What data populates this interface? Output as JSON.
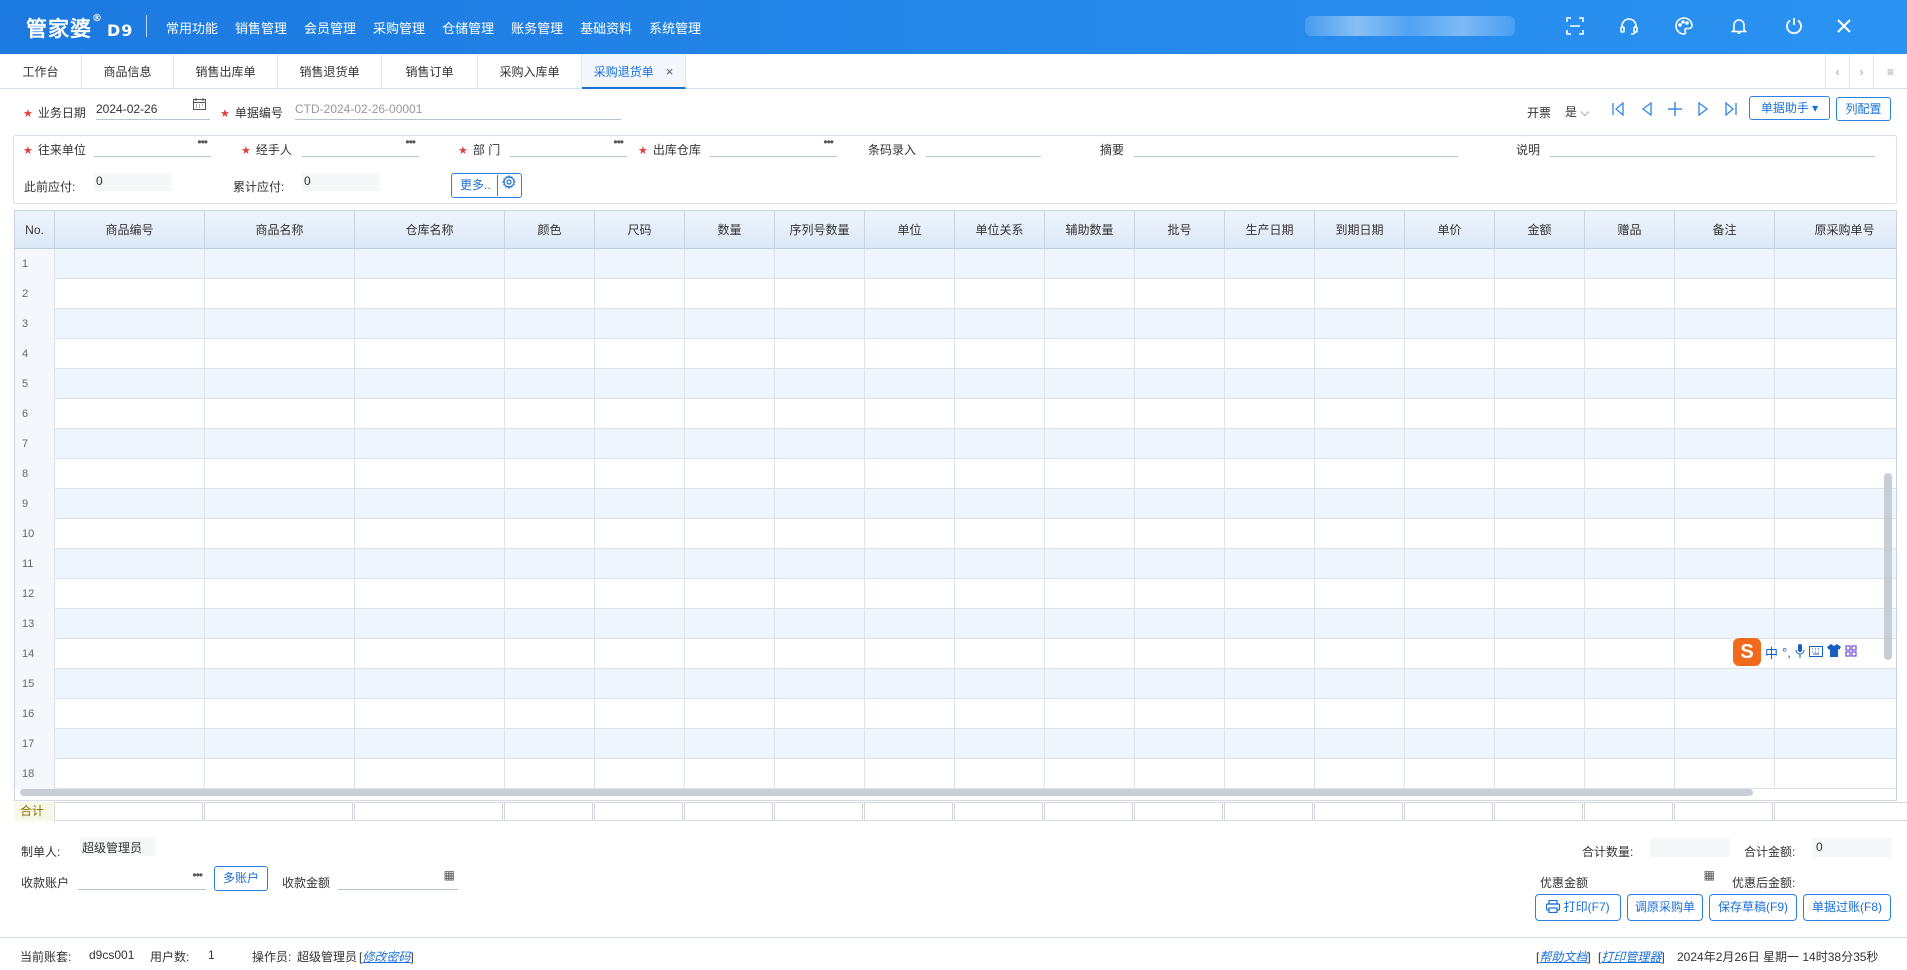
{
  "app": {
    "logo": "管家婆",
    "logo_mark": "®",
    "version": "D9"
  },
  "top_nav": [
    "常用功能",
    "销售管理",
    "会员管理",
    "采购管理",
    "仓储管理",
    "账务管理",
    "基础资料",
    "系统管理"
  ],
  "tabs": [
    {
      "label": "工作台"
    },
    {
      "label": "商品信息"
    },
    {
      "label": "销售出库单"
    },
    {
      "label": "销售退货单"
    },
    {
      "label": "销售订单"
    },
    {
      "label": "采购入库单"
    },
    {
      "label": "采购退货单",
      "active": true
    }
  ],
  "form": {
    "biz_date_label": "业务日期",
    "biz_date_value": "2024-02-26",
    "doc_no_label": "单据编号",
    "doc_no_placeholder": "CTD-2024-02-26-00001",
    "invoice_label": "开票",
    "invoice_value": "是",
    "assistant_label": "单据助手 ▾",
    "column_config_label": "列配置",
    "partner_label": "往来单位",
    "handler_label": "经手人",
    "dept_label": "部 门",
    "warehouse_label": "出库仓库",
    "barcode_label": "条码录入",
    "summary_label": "摘要",
    "remark_label": "说明",
    "prev_payable_label": "此前应付:",
    "prev_payable_value": "0",
    "total_payable_label": "累计应付:",
    "total_payable_value": "0",
    "more_label": "更多.."
  },
  "grid": {
    "columns": [
      "No.",
      "商品编号",
      "商品名称",
      "仓库名称",
      "颜色",
      "尺码",
      "数量",
      "序列号数量",
      "单位",
      "单位关系",
      "辅助数量",
      "批号",
      "生产日期",
      "到期日期",
      "单价",
      "金额",
      "赠品",
      "备注",
      "原采购单号"
    ],
    "rows": [
      "1",
      "2",
      "3",
      "4",
      "5",
      "6",
      "7",
      "8",
      "9",
      "10",
      "11",
      "12",
      "13",
      "14",
      "15",
      "16",
      "17",
      "18"
    ],
    "sum_label": "合计"
  },
  "ime": {
    "logo": "S",
    "label": "中",
    "punct": "°,"
  },
  "footer": {
    "maker_label": "制单人:",
    "maker_value": "超级管理员",
    "account_label": "收款账户",
    "multi_account": "多账户",
    "amount_label": "收款金额",
    "total_qty_label": "合计数量:",
    "total_amount_label": "合计金额:",
    "total_amount_value": "0",
    "discount_label": "优惠金额",
    "after_discount_label": "优惠后金额:",
    "buttons": [
      "打印(F7)",
      "调原采购单",
      "保存草稿(F9)",
      "单据过账(F8)"
    ]
  },
  "status": {
    "account_label": "当前账套:",
    "account_value": "d9cs001",
    "users_label": "用户数:",
    "users_value": "1",
    "operator_label": "操作员:",
    "operator_value": "超级管理员",
    "change_pwd": "修改密码",
    "help": "帮助文档",
    "printer": "打印管理器",
    "datetime": "2024年2月26日 星期一 14时38分35秒"
  }
}
